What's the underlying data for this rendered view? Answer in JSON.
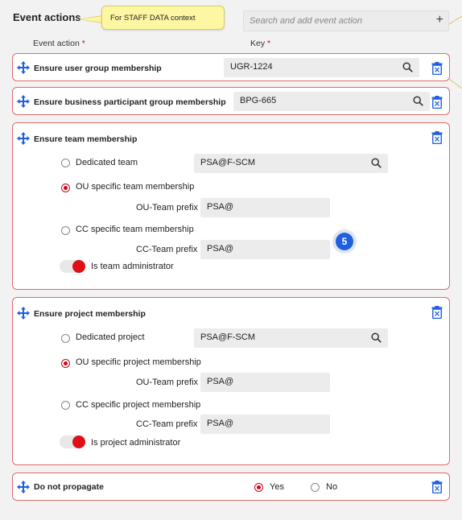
{
  "header": {
    "title": "Event actions",
    "sticky_note": "For STAFF DATA context",
    "search_placeholder": "Search and add event action",
    "add_icon": "+"
  },
  "columns": {
    "action_label": "Event action",
    "key_label": "Key",
    "required_mark": "*"
  },
  "cards": {
    "user_group": {
      "title": "Ensure user group membership",
      "key": "UGR-1224"
    },
    "business_group": {
      "title": "Ensure business participant group membership",
      "key": "BPG-665"
    },
    "team": {
      "title": "Ensure team membership",
      "opt_dedicated": "Dedicated team",
      "dedicated_value": "PSA@F-SCM",
      "opt_ou": "OU specific team membership",
      "ou_prefix_label": "OU-Team prefix",
      "ou_prefix_value": "PSA@",
      "opt_cc": "CC specific team membership",
      "cc_prefix_label": "CC-Team prefix",
      "cc_prefix_value": "PSA@",
      "admin_label": "Is team administrator",
      "selected": "ou"
    },
    "project": {
      "title": "Ensure project membership",
      "opt_dedicated": "Dedicated project",
      "dedicated_value": "PSA@F-SCM",
      "opt_ou": "OU specific project membership",
      "ou_prefix_label": "OU-Team prefix",
      "ou_prefix_value": "PSA@",
      "opt_cc": "CC specific project membership",
      "cc_prefix_label": "CC-Team prefix",
      "cc_prefix_value": "PSA@",
      "admin_label": "Is project administrator",
      "selected": "ou"
    },
    "propagate": {
      "title": "Do not propagate",
      "yes_label": "Yes",
      "no_label": "No",
      "selected": "yes"
    }
  },
  "step_badge": "5",
  "colors": {
    "accent_red": "#d0021b",
    "card_border": "#e06a6a",
    "icon_blue": "#1f5fe0",
    "sticky_yellow": "#fdf7a3"
  },
  "icons": [
    "drag-move-icon",
    "trash-icon",
    "search-icon",
    "plus-icon"
  ]
}
